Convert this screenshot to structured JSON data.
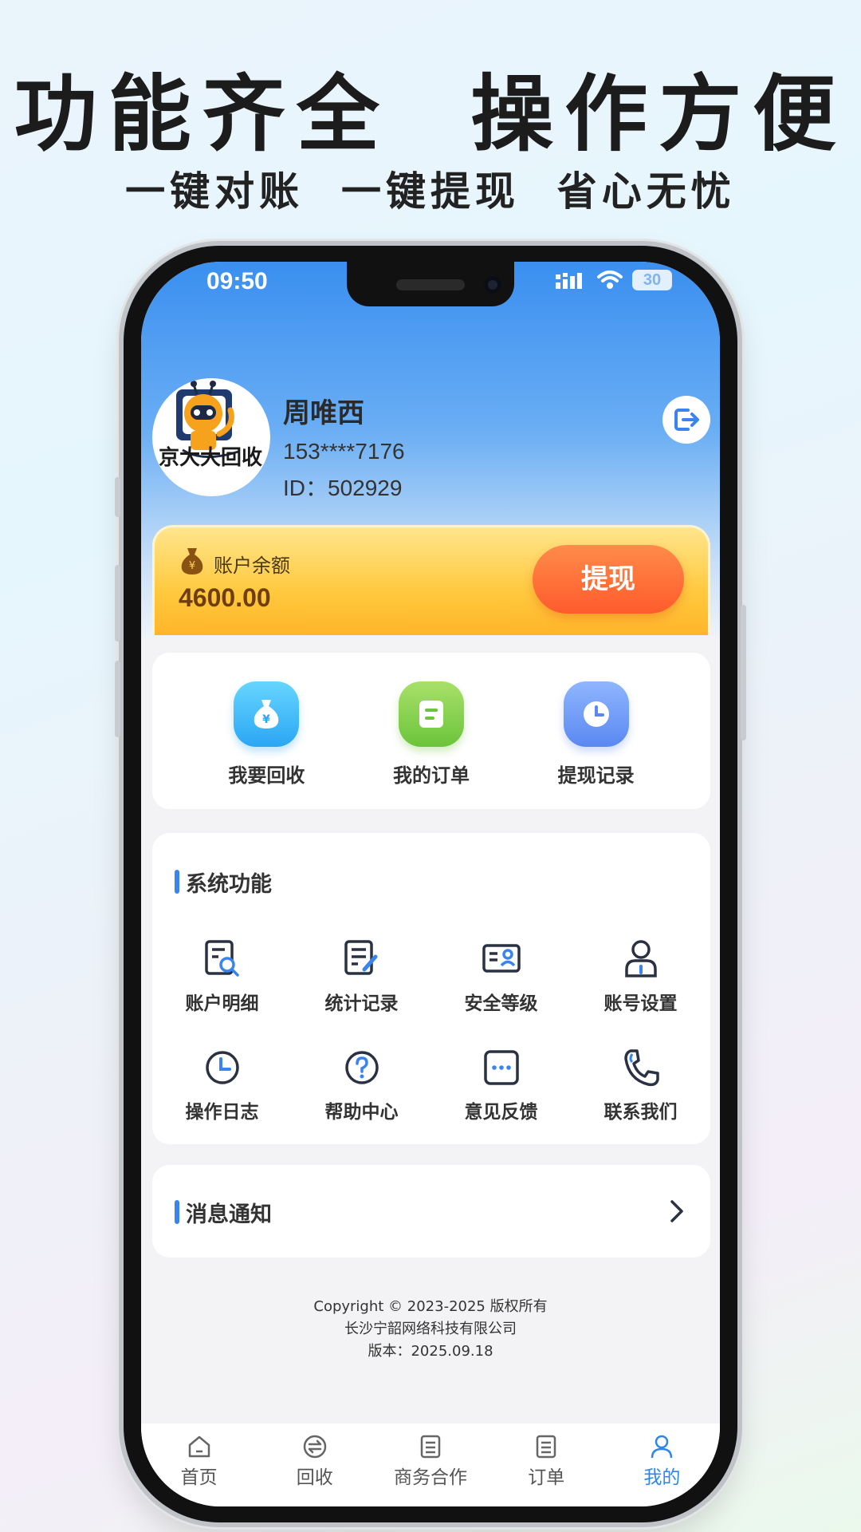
{
  "promo": {
    "headline": "功能齐全  操作方便",
    "subline": "一键对账  一键提现  省心无忧"
  },
  "status_bar": {
    "time": "09:50",
    "battery": "30"
  },
  "profile": {
    "name": "周唯西",
    "phone": "153****7176",
    "id": "ID：502929",
    "avatar_logo_text": "京大大回收"
  },
  "balance": {
    "label": "账户余额",
    "value": "4600.00",
    "withdraw_label": "提现"
  },
  "quick_actions": [
    {
      "label": "我要回收",
      "icon": "moneybag-icon"
    },
    {
      "label": "我的订单",
      "icon": "order-icon"
    },
    {
      "label": "提现记录",
      "icon": "clock-icon"
    }
  ],
  "system": {
    "title": "系统功能",
    "items": [
      {
        "label": "账户明细",
        "icon": "document-search-icon"
      },
      {
        "label": "统计记录",
        "icon": "document-edit-icon"
      },
      {
        "label": "安全等级",
        "icon": "id-card-icon"
      },
      {
        "label": "账号设置",
        "icon": "user-icon"
      },
      {
        "label": "操作日志",
        "icon": "clock-icon"
      },
      {
        "label": "帮助中心",
        "icon": "question-icon"
      },
      {
        "label": "意见反馈",
        "icon": "chat-icon"
      },
      {
        "label": "联系我们",
        "icon": "phone-icon"
      }
    ]
  },
  "notice": {
    "title": "消息通知"
  },
  "footer": {
    "copyright": "Copyright © 2023-2025 版权所有",
    "company": "长沙宁韶网络科技有限公司",
    "version": "版本：2025.09.18"
  },
  "tabbar": [
    {
      "label": "首页",
      "icon": "home-icon",
      "active": false
    },
    {
      "label": "回收",
      "icon": "exchange-icon",
      "active": false
    },
    {
      "label": "商务合作",
      "icon": "list-icon",
      "active": false
    },
    {
      "label": "订单",
      "icon": "list-icon",
      "active": false
    },
    {
      "label": "我的",
      "icon": "user-icon",
      "active": true
    }
  ],
  "colors": {
    "accent": "#2f86e8",
    "withdraw": "#ff5b2c",
    "card_gold": "#ffc93e"
  }
}
